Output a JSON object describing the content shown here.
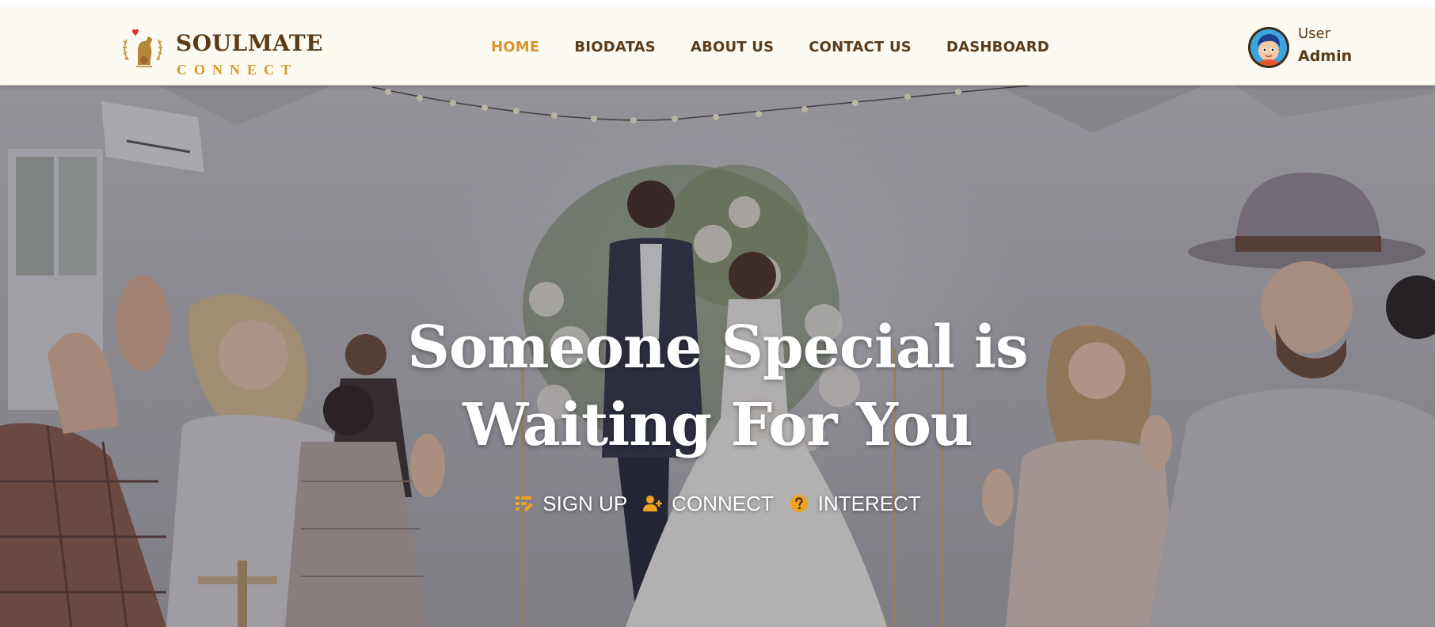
{
  "brand": {
    "name": "SOULMATE",
    "tagline": "CONNECT",
    "logo_icon": "dog-with-heart-wreath-icon"
  },
  "nav": {
    "items": [
      {
        "label": "HOME",
        "active": true
      },
      {
        "label": "BIODATAS",
        "active": false
      },
      {
        "label": "ABOUT US",
        "active": false
      },
      {
        "label": "CONTACT US",
        "active": false
      },
      {
        "label": "DASHBOARD",
        "active": false
      }
    ]
  },
  "user": {
    "role": "User",
    "name": "Admin",
    "avatar_icon": "cartoon-boy-avatar"
  },
  "hero": {
    "title_line1": "Someone Special is",
    "title_line2": "Waiting For You",
    "actions": [
      {
        "label": "SIGN UP",
        "icon": "signup-form-icon"
      },
      {
        "label": "CONNECT",
        "icon": "user-plus-icon"
      },
      {
        "label": "INTERECT",
        "icon": "question-circle-icon"
      }
    ]
  },
  "colors": {
    "header_bg": "#fdfaf2",
    "brand_brown": "#5b3c18",
    "accent_gold": "#d5962d",
    "nav_text": "#5a3b1a",
    "hero_text": "#ffffff"
  }
}
